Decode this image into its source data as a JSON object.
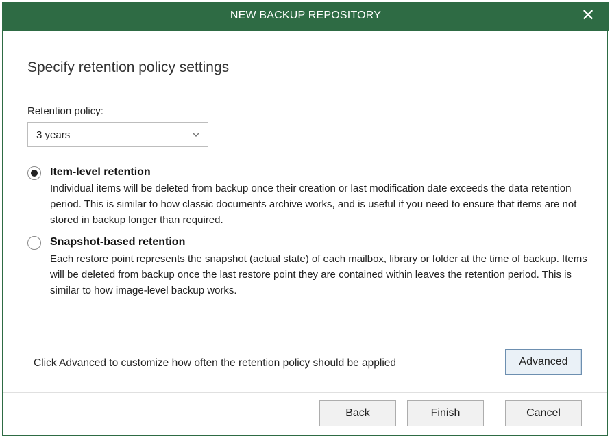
{
  "window": {
    "title": "NEW BACKUP REPOSITORY",
    "close_icon": "close-icon",
    "accent_color": "#2e6b44"
  },
  "page": {
    "heading": "Specify retention policy settings"
  },
  "retention": {
    "label": "Retention policy:",
    "selected": "3 years"
  },
  "options": [
    {
      "title": "Item-level retention",
      "checked": true,
      "description": "Individual items will be deleted from backup once their creation or last modification date exceeds the data retention period. This is similar to how classic documents archive works, and is useful if you need to ensure that items are not stored in backup longer than required."
    },
    {
      "title": "Snapshot-based retention",
      "checked": false,
      "description": "Each restore point represents the snapshot (actual state) of each mailbox, library or folder at the time of backup. Items will be deleted from backup once the last restore point they are contained within leaves the retention period. This is similar to how image-level backup works."
    }
  ],
  "advanced": {
    "hint": "Click Advanced to customize how often the retention policy should be applied",
    "button_label": "Advanced"
  },
  "footer": {
    "back_label": "Back",
    "finish_label": "Finish",
    "cancel_label": "Cancel"
  }
}
